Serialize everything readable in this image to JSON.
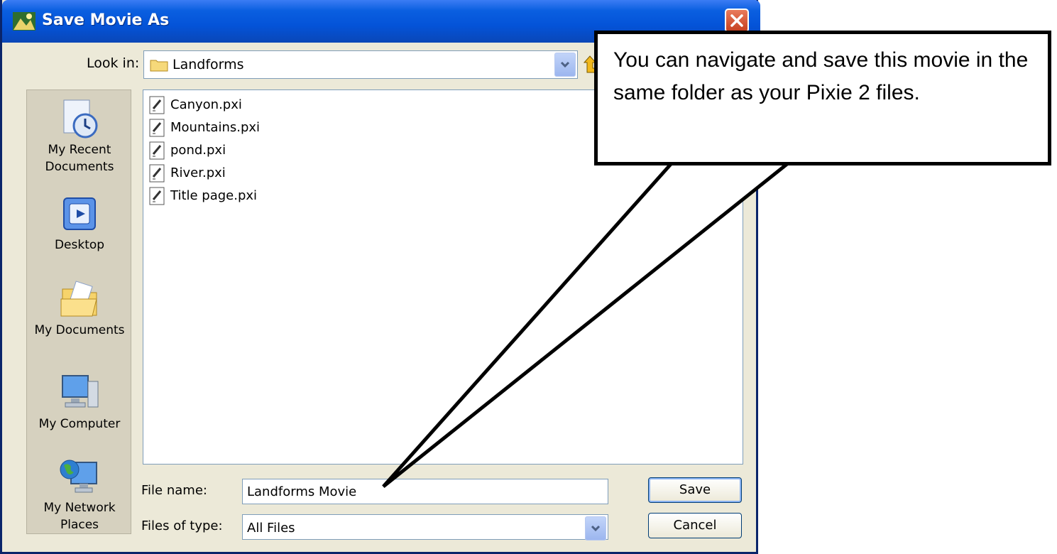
{
  "window": {
    "title": "Save Movie As"
  },
  "toolbar": {
    "lookin_label": "Look in:",
    "lookin_value": "Landforms"
  },
  "places": [
    {
      "label": "My Recent Documents",
      "icon": "recent-documents-icon"
    },
    {
      "label": "Desktop",
      "icon": "desktop-icon"
    },
    {
      "label": "My Documents",
      "icon": "my-documents-icon"
    },
    {
      "label": "My Computer",
      "icon": "my-computer-icon"
    },
    {
      "label": "My Network Places",
      "icon": "network-places-icon"
    }
  ],
  "files": [
    "Canyon.pxi",
    "Mountains.pxi",
    "pond.pxi",
    "River.pxi",
    "Title page.pxi"
  ],
  "form": {
    "filename_label": "File name:",
    "filename_value": "Landforms Movie",
    "filetype_label": "Files of type:",
    "filetype_value": "All Files",
    "save_label": "Save",
    "cancel_label": "Cancel"
  },
  "callout": {
    "text": "You can navigate and save this movie in the same folder as your Pixie 2 files."
  },
  "colors": {
    "titlebar": "#0453d8",
    "dialog_bg": "#ece9d8",
    "places_bg": "#d6d1bf",
    "close": "#c6401f"
  }
}
